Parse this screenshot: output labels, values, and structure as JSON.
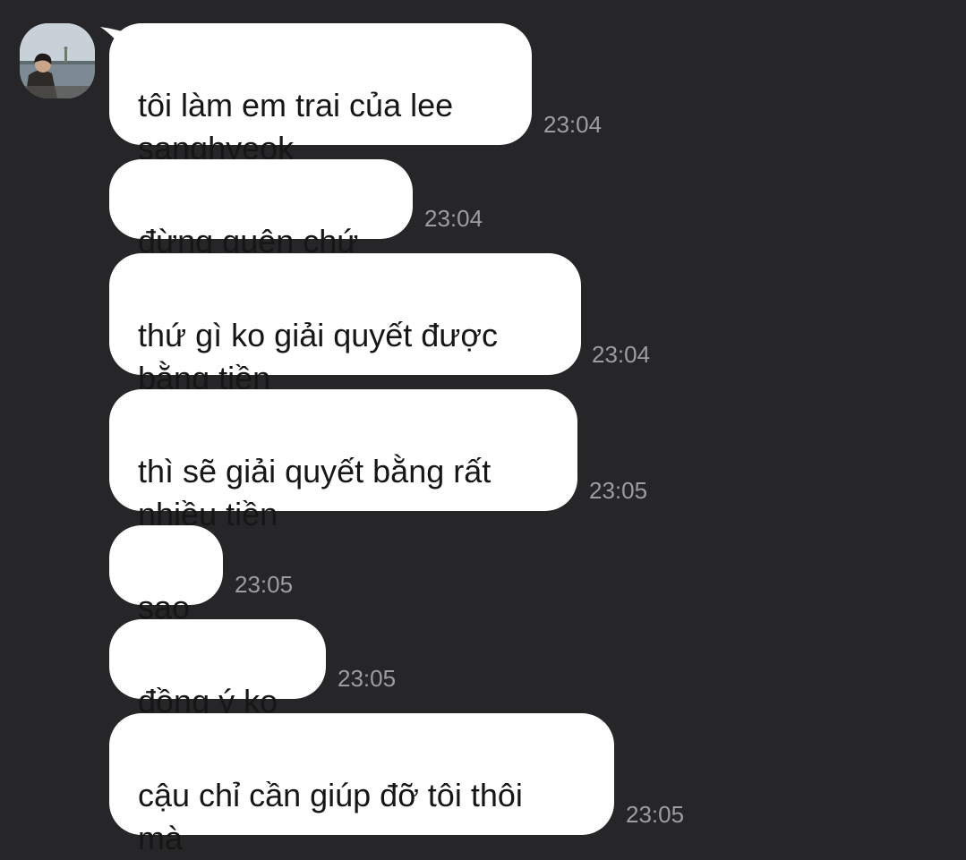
{
  "chat": {
    "contact_avatar": "profile-photo",
    "messages": [
      {
        "text": "tôi làm em trai của lee\nsanghyeok",
        "time": "23:04"
      },
      {
        "text": "đừng quên chứ",
        "time": "23:04"
      },
      {
        "text": "thứ gì ko giải quyết được\nbằng tiền",
        "time": "23:04"
      },
      {
        "text": "thì sẽ giải quyết bằng rất\nnhiều tiền",
        "time": "23:05"
      },
      {
        "text": "sao",
        "time": "23:05"
      },
      {
        "text": "đồng ý ko",
        "time": "23:05"
      },
      {
        "text": "cậu chỉ cần giúp đỡ tôi thôi\nmà",
        "time": "23:05"
      }
    ]
  },
  "colors": {
    "background": "#262629",
    "bubble": "#ffffff",
    "message_text": "#161616",
    "timestamp": "#9d9da1"
  }
}
